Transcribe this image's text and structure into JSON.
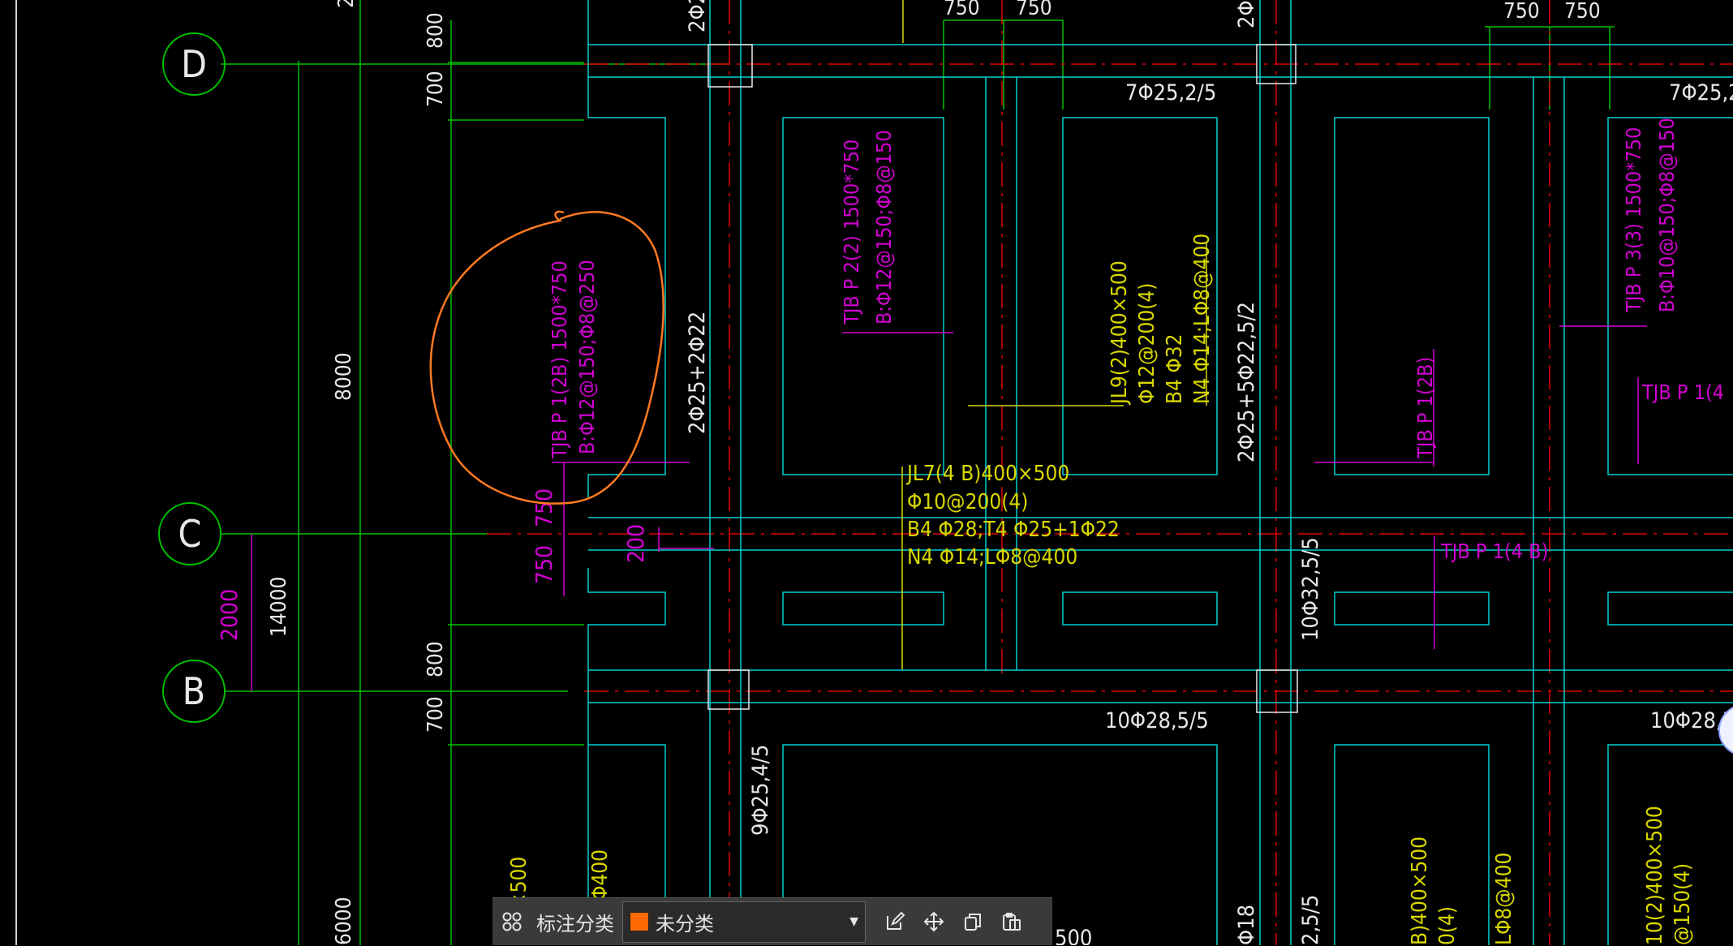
{
  "colors": {
    "background": "#000000",
    "axis_green": "#00c000",
    "outline_cyan": "#00d0d0",
    "label_magenta": "#d000d0",
    "label_yellow": "#d8d800",
    "axis_red": "#e00000",
    "dim_white": "#e8e8e8",
    "markup_orange": "#ff7a20",
    "category_orange": "#ff6a00"
  },
  "drawing": {
    "axes": [
      {
        "label": "D"
      },
      {
        "label": "C"
      },
      {
        "label": "B"
      }
    ],
    "dimensions": {
      "d_800": "800",
      "d_700": "700",
      "c_750_a": "750",
      "c_750_b": "750",
      "c_200": "200",
      "b_800": "800",
      "b_700": "700",
      "span_8000": "8000",
      "span_2000": "2000",
      "span_14000": "14000",
      "span_6000": "6000",
      "top_750_1": "750",
      "top_750_2": "750",
      "top_750_3": "750",
      "top_750_4": "750",
      "top_2": "2"
    },
    "labels": {
      "tjbp1_name": "TJB P 1(2B) 1500*750",
      "tjbp1_rebar": "B:Φ12@150;Φ8@250",
      "tjbp2_name": "TJB P 2(2) 1500*750",
      "tjbp2_rebar": "B:Φ12@150;Φ8@150",
      "tjbp3_name": "TJB P 3(3) 1500*750",
      "tjbp3_rebar": "B:Φ10@150;Φ8@150",
      "tjbp1_2b": "TJB P 1(2B)",
      "tjbp1_4": "TJB P 1(4",
      "tjbp1_4b": "TJB P 1(4 B)",
      "jl9_1": "JL9(2)400×500",
      "jl9_2": "Φ12@200(4)",
      "jl9_3": "B4 Φ32",
      "jl9_4": "N4 Φ14;LΦ8@400",
      "jl7_1": "JL7(4 B)400×500",
      "jl7_2": "Φ10@200(4)",
      "jl7_3": "B4 Φ28;T4 Φ25+1Φ22",
      "jl7_4": "N4 Φ14;LΦ8@400",
      "r_2phi22": "2Φ25+2Φ22",
      "r_2phi22_5": "2Φ25+5Φ22,5/2",
      "r_7phi25_a": "7Φ25,2/5",
      "r_7phi25_b": "7Φ25,2",
      "r_10phi32": "10Φ32,5/5",
      "r_10phi28_a": "10Φ28,5/5",
      "r_10phi28_b": "10Φ28,5",
      "r_9phi25": "9Φ25,4/5",
      "r_top_a": "2Φ2",
      "r_top_b": "2Φ",
      "b_500": "×500",
      "b_400": "Φ400",
      "b_phi18": "Φ18",
      "b_25": "2,5/5",
      "b_jl_a": "B)400×500",
      "b_jl_b": "0(4)",
      "b_l8": "LΦ8@400",
      "b_10_2": "10(2)400×500",
      "b_150": "@150(4)",
      "b_500b": "500"
    }
  },
  "toolbar": {
    "label": "标注分类",
    "category_value": "未分类",
    "grid_icon": "grid-icon",
    "edit_icon": "edit-icon",
    "move_icon": "move-icon",
    "copy_icon": "copy-icon",
    "paste_icon": "paste-icon"
  }
}
